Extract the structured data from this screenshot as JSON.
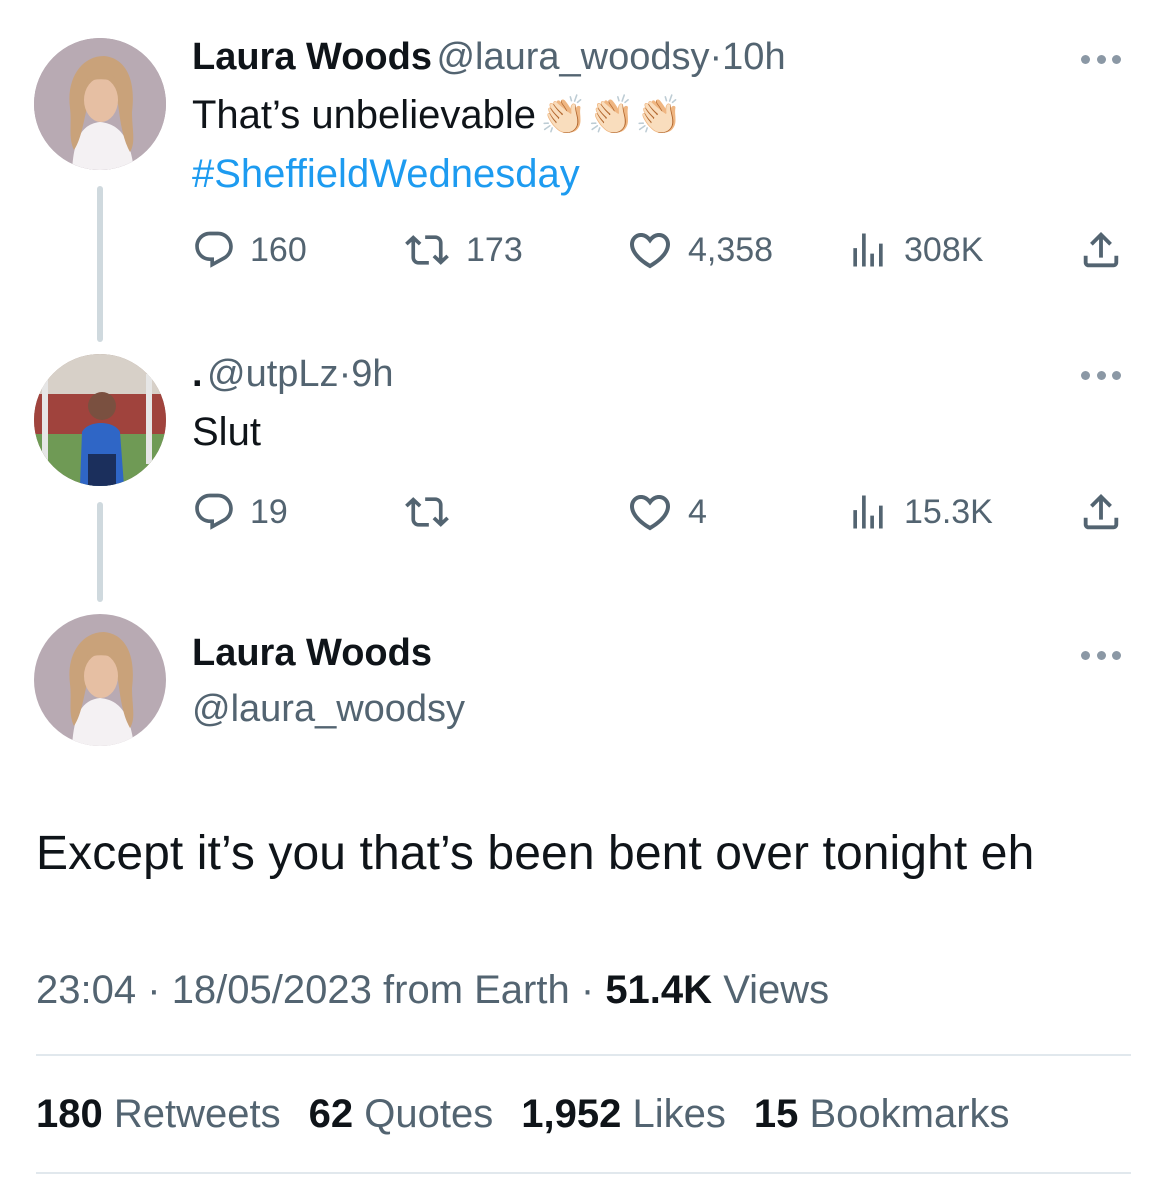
{
  "tweet1": {
    "name": "Laura Woods",
    "handle": "@laura_woodsy",
    "separator": "·",
    "time": "10h",
    "text": "That’s unbelievable",
    "emoji": "👏🏻👏🏻👏🏻",
    "hashtag": "#SheffieldWednesday",
    "replies": "160",
    "retweets": "173",
    "likes": "4,358",
    "views": "308K"
  },
  "tweet2": {
    "name": ".",
    "handle": "@utpLz",
    "separator": "·",
    "time": "9h",
    "text": "Slut",
    "replies": "19",
    "retweets": "",
    "likes": "4",
    "views": "15.3K"
  },
  "main": {
    "name": "Laura Woods",
    "handle": "@laura_woodsy",
    "text": "Except it’s you that’s been bent over tonight eh",
    "time": "23:04",
    "dot1": "·",
    "date": "18/05/2023",
    "source": "from Earth",
    "dot2": "·",
    "views_count": "51.4K",
    "views_label": "Views",
    "stats": [
      {
        "count": "180",
        "label": "Retweets"
      },
      {
        "count": "62",
        "label": "Quotes"
      },
      {
        "count": "1,952",
        "label": "Likes"
      },
      {
        "count": "15",
        "label": "Bookmarks"
      }
    ]
  },
  "colors": {
    "hashtag": "#1d9bf0",
    "secondary_text": "#536471",
    "thread_line": "#cfd9de"
  },
  "icons": [
    "reply-icon",
    "retweet-icon",
    "like-icon",
    "views-icon",
    "share-icon",
    "more-icon"
  ]
}
